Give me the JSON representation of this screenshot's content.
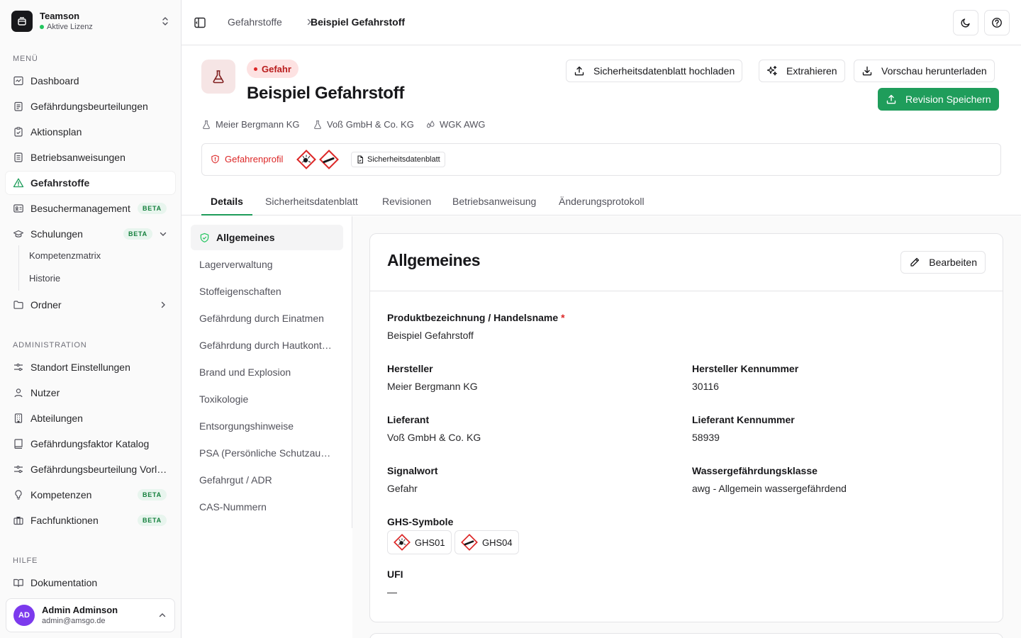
{
  "org": {
    "name": "Teamson",
    "license": "Aktive Lizenz"
  },
  "sidebar": {
    "menu_label": "MENÜ",
    "menu": [
      {
        "label": "Dashboard",
        "icon": "dashboard-icon"
      },
      {
        "label": "Gefährdungsbeurteilungen",
        "icon": "clipboard-list-icon"
      },
      {
        "label": "Aktionsplan",
        "icon": "clipboard-check-icon"
      },
      {
        "label": "Betriebsanweisungen",
        "icon": "document-icon"
      },
      {
        "label": "Gefahrstoffe",
        "icon": "warning-triangle-icon",
        "active": true
      },
      {
        "label": "Besuchermanagement",
        "icon": "id-card-icon",
        "badge": "BETA"
      },
      {
        "label": "Schulungen",
        "icon": "graduation-cap-icon",
        "badge": "BETA"
      },
      {
        "label": "Ordner",
        "icon": "folder-icon"
      }
    ],
    "sub_items": [
      "Kompetenzmatrix",
      "Historie"
    ],
    "admin_label": "ADMINISTRATION",
    "admin": [
      {
        "label": "Standort Einstellungen",
        "icon": "sliders-icon"
      },
      {
        "label": "Nutzer",
        "icon": "user-icon"
      },
      {
        "label": "Abteilungen",
        "icon": "building-icon"
      },
      {
        "label": "Gefährdungsfaktor Katalog",
        "icon": "book-icon"
      },
      {
        "label": "Gefährdungsbeurteilung Vorlagen",
        "icon": "sliders-icon"
      },
      {
        "label": "Kompetenzen",
        "icon": "lightbulb-icon",
        "badge": "BETA"
      },
      {
        "label": "Fachfunktionen",
        "icon": "briefcase-icon",
        "badge": "BETA"
      }
    ],
    "help_label": "HILFE",
    "help": [
      {
        "label": "Dokumentation",
        "icon": "open-book-icon"
      }
    ]
  },
  "user": {
    "initials": "AD",
    "name": "Admin Adminson",
    "email": "admin@amsgo.de"
  },
  "breadcrumb": {
    "parent": "Gefahrstoffe",
    "current": "Beispiel Gefahrstoff"
  },
  "header": {
    "signal_badge": "Gefahr",
    "title": "Beispiel Gefahrstoff",
    "upload_button": "Sicherheitsdatenblatt hochladen",
    "extract_button": "Extrahieren",
    "download_button": "Vorschau herunterladen",
    "save_button": "Revision Speichern",
    "meta": {
      "manufacturer": "Meier Bergmann KG",
      "supplier": "Voß GmbH & Co. KG",
      "wgk": "WGK AWG"
    },
    "hazard_profile": "Gefahrenprofil",
    "sds_chip": "Sicherheitsdatenblatt"
  },
  "tabs": [
    "Details",
    "Sicherheitsdatenblatt",
    "Revisionen",
    "Betriebsanweisung",
    "Änderungsprotokoll"
  ],
  "subnav": [
    "Allgemeines",
    "Lagerverwaltung",
    "Stoffeigenschaften",
    "Gefährdung durch Einatmen",
    "Gefährdung durch Hautkontakt",
    "Brand und Explosion",
    "Toxikologie",
    "Entsorgungshinweise",
    "PSA (Persönliche Schutzausrüstung)",
    "Gefahrgut / ADR",
    "CAS-Nummern"
  ],
  "card": {
    "title": "Allgemeines",
    "edit_button": "Bearbeiten",
    "fields": {
      "product_label": "Produktbezeichnung / Handelsname",
      "required_mark": "*",
      "product_value": "Beispiel Gefahrstoff",
      "manufacturer_label": "Hersteller",
      "manufacturer_value": "Meier Bergmann KG",
      "manufacturer_no_label": "Hersteller Kennummer",
      "manufacturer_no_value": "30116",
      "supplier_label": "Lieferant",
      "supplier_value": "Voß GmbH & Co. KG",
      "supplier_no_label": "Lieferant Kennummer",
      "supplier_no_value": "58939",
      "signal_label": "Signalwort",
      "signal_value": "Gefahr",
      "wgk_label": "Wassergefährdungsklasse",
      "wgk_value": "awg - Allgemein wassergefährdend",
      "ghs_label": "GHS-Symbole",
      "ghs": [
        "GHS01",
        "GHS04"
      ],
      "ufi_label": "UFI",
      "ufi_value": "—"
    }
  },
  "colors": {
    "accent": "#1f9d5b",
    "danger": "#dc2626",
    "danger_bg": "#fde2e2"
  }
}
